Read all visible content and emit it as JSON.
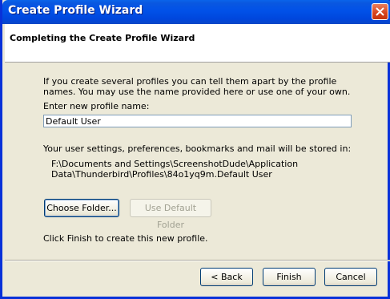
{
  "window": {
    "title": "Create Profile Wizard"
  },
  "header": {
    "title": "Completing the Create Profile Wizard"
  },
  "body": {
    "intro_text": "If you create several profiles you can tell them apart by the profile names. You may use the name provided here or use one of your own.",
    "name_label": "Enter new profile name:",
    "name_value": "Default User",
    "storage_text": "Your user settings, preferences, bookmarks and mail will be stored in:",
    "storage_path": "F:\\Documents and Settings\\ScreenshotDude\\Application Data\\Thunderbird\\Profiles\\84o1yq9m.Default User",
    "choose_folder_label": "Choose Folder...",
    "use_default_folder_label": "Use Default Folder",
    "finish_hint": "Click Finish to create this new profile."
  },
  "footer": {
    "back_label": "< Back",
    "finish_label": "Finish",
    "cancel_label": "Cancel"
  }
}
